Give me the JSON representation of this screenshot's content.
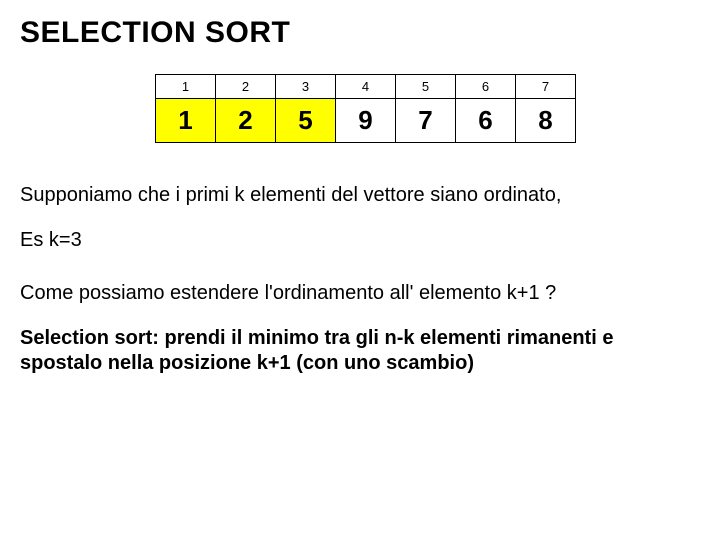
{
  "title": "SELECTION SORT",
  "array": {
    "indices": [
      "1",
      "2",
      "3",
      "4",
      "5",
      "6",
      "7"
    ],
    "values": [
      "1",
      "2",
      "5",
      "9",
      "7",
      "6",
      "8"
    ],
    "sorted_count": 3
  },
  "text": {
    "supponiamo": "Supponiamo che i primi k elementi del vettore siano ordinato,",
    "esk": "Es k=3",
    "question": "Come possiamo estendere l'ordinamento all' elemento k+1 ?",
    "algo": "Selection sort: prendi il minimo tra gli n-k elementi rimanenti e spostalo nella posizione k+1 (con uno scambio)"
  }
}
